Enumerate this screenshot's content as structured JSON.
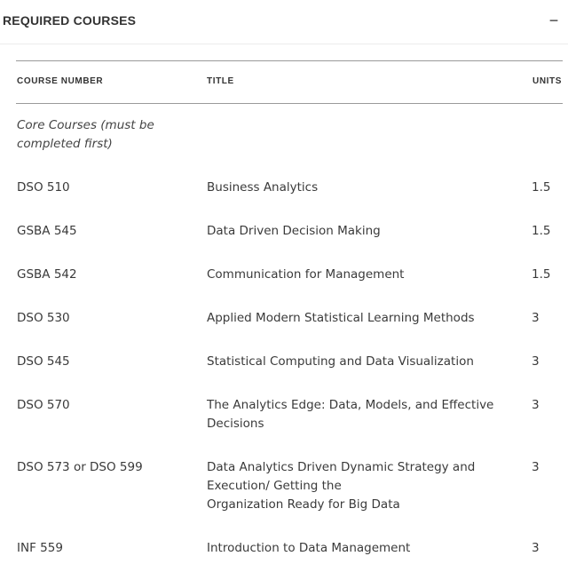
{
  "section": {
    "title": "REQUIRED COURSES",
    "toggle_symbol": "−"
  },
  "table": {
    "headers": {
      "course_number": "COURSE NUMBER",
      "title": "TITLE",
      "units": "UNITS"
    },
    "group_label": "Core Courses (must be completed first)",
    "rows": [
      {
        "number": "DSO 510",
        "title_lines": [
          "Business Analytics"
        ],
        "units": "1.5"
      },
      {
        "number": "GSBA 545",
        "title_lines": [
          "Data Driven Decision Making"
        ],
        "units": "1.5"
      },
      {
        "number": "GSBA 542",
        "title_lines": [
          "Communication for Management"
        ],
        "units": "1.5"
      },
      {
        "number": "DSO 530",
        "title_lines": [
          "Applied Modern Statistical Learning Methods"
        ],
        "units": "3"
      },
      {
        "number": "DSO 545",
        "title_lines": [
          "Statistical Computing and Data Visualization"
        ],
        "units": "3"
      },
      {
        "number": "DSO 570",
        "title_lines": [
          "The Analytics Edge: Data, Models, and Effective Decisions"
        ],
        "units": "3"
      },
      {
        "number": "DSO 573 or DSO 599",
        "title_lines": [
          "Data Analytics Driven Dynamic Strategy and Execution/ Getting the",
          "Organization Ready for Big Data"
        ],
        "units": "3"
      },
      {
        "number": "INF 559",
        "title_lines": [
          "Introduction to Data Management"
        ],
        "units": "3"
      }
    ]
  }
}
